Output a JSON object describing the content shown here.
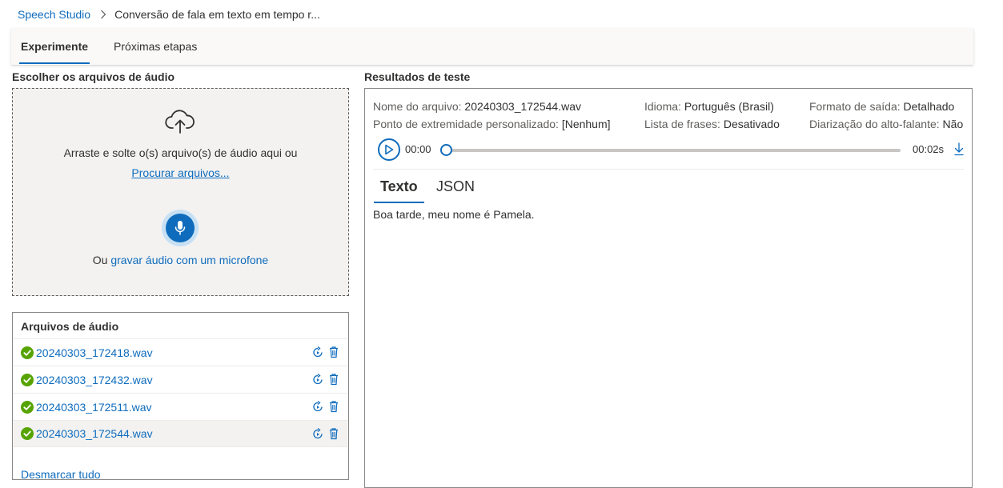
{
  "breadcrumb": {
    "root": "Speech Studio",
    "current": "Conversão de fala em texto em tempo r..."
  },
  "tabs": [
    {
      "label": "Experimente",
      "active": true
    },
    {
      "label": "Próximas etapas",
      "active": false
    }
  ],
  "upload": {
    "section_title": "Escolher os arquivos de áudio",
    "drop_text": "Arraste e solte o(s) arquivo(s) de áudio aqui ou",
    "browse_label": "Procurar arquivos...",
    "mic_prefix": "Ou",
    "mic_link": "gravar áudio com um microfone"
  },
  "audio_files": {
    "title": "Arquivos de áudio",
    "files": [
      {
        "name": "20240303_172418.wav",
        "status": "success",
        "selected": false
      },
      {
        "name": "20240303_172432.wav",
        "status": "success",
        "selected": false
      },
      {
        "name": "20240303_172511.wav",
        "status": "success",
        "selected": false
      },
      {
        "name": "20240303_172544.wav",
        "status": "success",
        "selected": true
      }
    ],
    "clear_all": "Desmarcar tudo"
  },
  "results": {
    "section_title": "Resultados de teste",
    "meta": {
      "file_name_label": "Nome do arquivo:",
      "file_name_value": "20240303_172544.wav",
      "language_label": "Idioma:",
      "language_value": "Português (Brasil)",
      "output_format_label": "Formato de saída:",
      "output_format_value": "Detalhado",
      "endpoint_label": "Ponto de extremidade personalizado:",
      "endpoint_value": "[Nenhum]",
      "phrase_list_label": "Lista de frases:",
      "phrase_list_value": "Desativado",
      "diarization_label": "Diarização do alto-falante:",
      "diarization_value": "Não"
    },
    "player": {
      "current_time": "00:00",
      "duration": "00:02s",
      "progress": 0
    },
    "tabs": [
      {
        "label": "Texto",
        "active": true
      },
      {
        "label": "JSON",
        "active": false
      }
    ],
    "transcript": "Boa tarde, meu nome é Pamela."
  },
  "colors": {
    "accent": "#0f6cbd",
    "success": "#57a300",
    "panel_bg": "#f3f2f1"
  },
  "icons": {
    "breadcrumb_separator": "chevron-right-icon",
    "upload": "cloud-upload-icon",
    "mic": "microphone-icon",
    "file_status": "check-circle-icon",
    "file_action_1": "retry-icon",
    "file_action_2": "trash-icon",
    "play": "play-icon",
    "download": "download-icon"
  }
}
